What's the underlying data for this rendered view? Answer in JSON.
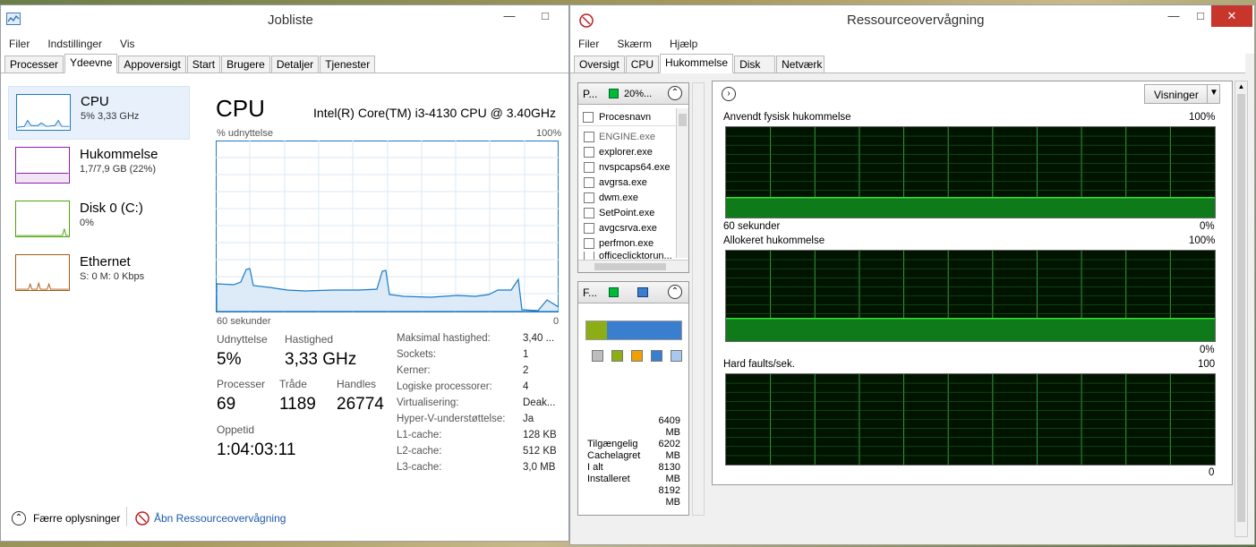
{
  "task_manager": {
    "title": "Jobliste",
    "menu": [
      "Filer",
      "Indstillinger",
      "Vis"
    ],
    "tabs": [
      "Processer",
      "Ydeevne",
      "Appoversigt",
      "Start",
      "Brugere",
      "Detaljer",
      "Tjenester"
    ],
    "active_tab": "Ydeevne",
    "sidebar": [
      {
        "title": "CPU",
        "sub": "5% 3,33 GHz"
      },
      {
        "title": "Hukommelse",
        "sub": "1,7/7,9 GB (22%)"
      },
      {
        "title": "Disk 0 (C:)",
        "sub": "0%"
      },
      {
        "title": "Ethernet",
        "sub": "S: 0 M: 0 Kbps"
      }
    ],
    "main": {
      "heading": "CPU",
      "cpu_name": "Intel(R) Core(TM) i3-4130 CPU @ 3.40GHz",
      "graph_top_left": "% udnyttelse",
      "graph_top_right": "100%",
      "graph_bottom_left": "60 sekunder",
      "graph_bottom_right": "0",
      "stats": {
        "util_label": "Udnyttelse",
        "util_value": "5%",
        "speed_label": "Hastighed",
        "speed_value": "3,33 GHz",
        "proc_label": "Processer",
        "proc_value": "69",
        "threads_label": "Tråde",
        "threads_value": "1189",
        "handles_label": "Handles",
        "handles_value": "26774",
        "uptime_label": "Oppetid",
        "uptime_value": "1:04:03:11"
      },
      "details": [
        {
          "k": "Maksimal hastighed:",
          "v": "3,40 ..."
        },
        {
          "k": "Sockets:",
          "v": "1"
        },
        {
          "k": "Kerner:",
          "v": "2"
        },
        {
          "k": "Logiske processorer:",
          "v": "4"
        },
        {
          "k": "Virtualisering:",
          "v": "Deak..."
        },
        {
          "k": "Hyper-V-understøttelse:",
          "v": "Ja"
        },
        {
          "k": "L1-cache:",
          "v": "128 KB"
        },
        {
          "k": "L2-cache:",
          "v": "512 KB"
        },
        {
          "k": "L3-cache:",
          "v": "3,0 MB"
        }
      ]
    },
    "footer": {
      "fewer": "Færre oplysninger",
      "open_rm": "Åbn Ressourceovervågning"
    }
  },
  "resource_monitor": {
    "title": "Ressourceovervågning",
    "menu": [
      "Filer",
      "Skærm",
      "Hjælp"
    ],
    "tabs": [
      "Oversigt",
      "CPU",
      "Hukommelse",
      "Disk",
      "Netværk"
    ],
    "active_tab": "Hukommelse",
    "proc_pane": {
      "head_label": "P...",
      "head_pct": "20%...",
      "col_header": "Procesnavn",
      "rows": [
        "ENGINE.exe",
        "explorer.exe",
        "nvspcaps64.exe",
        "avgrsa.exe",
        "dwm.exe",
        "SetPoint.exe",
        "avgcsrva.exe",
        "perfmon.exe",
        "officeclicktorun..."
      ]
    },
    "mem_pane": {
      "head_label": "F...",
      "values": [
        "6409",
        "MB",
        "6202",
        "MB",
        "8130",
        "MB",
        "8192",
        "MB"
      ],
      "labels": [
        "Tilgængelig",
        "Cachelagret",
        "I alt",
        "Installeret"
      ],
      "legend_colors": [
        "#bdbdbd",
        "#8cae14",
        "#f0a000",
        "#3a7ecf",
        "#a9c8ee"
      ],
      "bar_used_fraction": 0.22
    },
    "views_button": "Visninger",
    "graphs": [
      {
        "title": "Anvendt fysisk hukommelse",
        "top": "100%",
        "bottom_left": "60 sekunder",
        "bottom_right": "0%",
        "level": 0.22
      },
      {
        "title": "Allokeret hukommelse",
        "top": "100%",
        "bottom_left": "",
        "bottom_right": "0%",
        "level": 0.25
      },
      {
        "title": "Hard faults/sek.",
        "top": "100",
        "bottom_left": "",
        "bottom_right": "0",
        "level": 0.0
      }
    ]
  }
}
